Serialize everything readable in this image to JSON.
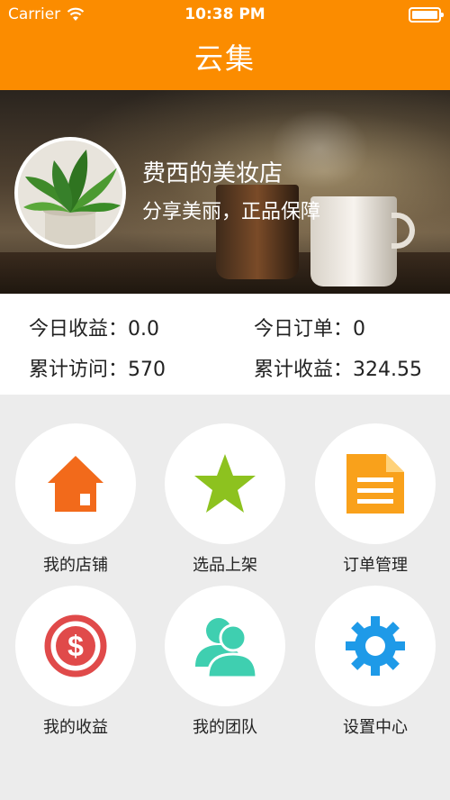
{
  "status_bar": {
    "carrier": "Carrier",
    "time": "10:38 PM"
  },
  "nav": {
    "title": "云集"
  },
  "shop": {
    "name": "费西的美妆店",
    "slogan": "分享美丽，正品保障"
  },
  "stats": [
    {
      "label": "今日收益：",
      "value": "0.0"
    },
    {
      "label": "今日订单：",
      "value": "0"
    },
    {
      "label": "累计访问：",
      "value": "570"
    },
    {
      "label": "累计收益：",
      "value": "324.55"
    }
  ],
  "menu": [
    {
      "label": "我的店铺",
      "icon": "home-icon",
      "color": "#f26a1b"
    },
    {
      "label": "选品上架",
      "icon": "star-icon",
      "color": "#8dc21f"
    },
    {
      "label": "订单管理",
      "icon": "document-icon",
      "color": "#f9a11b"
    },
    {
      "label": "我的收益",
      "icon": "dollar-icon",
      "color": "#e04a4a"
    },
    {
      "label": "我的团队",
      "icon": "team-icon",
      "color": "#3fcfb0"
    },
    {
      "label": "设置中心",
      "icon": "gear-icon",
      "color": "#1e9ae8"
    }
  ],
  "colors": {
    "accent": "#fb8c00",
    "background": "#ececec"
  }
}
